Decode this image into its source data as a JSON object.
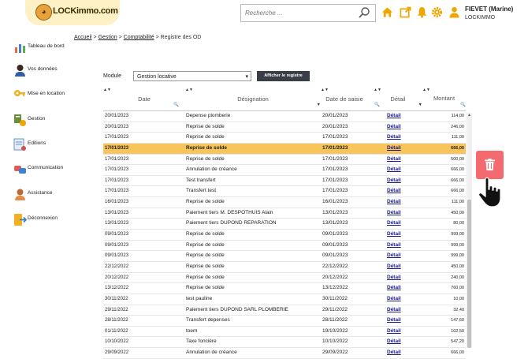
{
  "brand": {
    "logo_text": "LOCKimmo.com"
  },
  "search": {
    "placeholder": "Recherche ..."
  },
  "header_icons": [
    "home-icon",
    "external-link-icon",
    "bell-icon",
    "gear-icon",
    "user-icon"
  ],
  "user": {
    "name": "FIEVET (Marine)",
    "org": "LOCKIMMO"
  },
  "sidebar": {
    "items": [
      {
        "label": "Tableau de bord",
        "icon": "dashboard-icon"
      },
      {
        "label": "Vos données",
        "icon": "person-icon"
      },
      {
        "label": "Mise en location",
        "icon": "key-icon"
      },
      {
        "label": "Gestion",
        "icon": "management-icon"
      },
      {
        "label": "Editions",
        "icon": "editions-icon"
      },
      {
        "label": "Communication",
        "icon": "communication-icon"
      },
      {
        "label": "Assistance",
        "icon": "assistance-icon"
      },
      {
        "label": "Déconnexion",
        "icon": "logout-icon"
      }
    ]
  },
  "breadcrumb": {
    "home": "Accueil",
    "sep": ">",
    "gestion": "Gestion",
    "compta": "Comptabilité",
    "current": "Registre des OD"
  },
  "module": {
    "label": "Module",
    "selected": "Gestion locative",
    "button": "Afficher le registre"
  },
  "table": {
    "columns": {
      "date": "Date",
      "designation": "Désignation",
      "saisie": "Date de saisie",
      "detail": "Détail",
      "montant": "Montant"
    },
    "rows": [
      {
        "date": "20/01/2023",
        "designation": "Depense plomberie",
        "saisie": "20/01/2023",
        "detail": "Détail",
        "montant": "114,00"
      },
      {
        "date": "20/01/2023",
        "designation": "Reprise de solde",
        "saisie": "20/01/2023",
        "detail": "Détail",
        "montant": "246,00"
      },
      {
        "date": "17/01/2023",
        "designation": "Reprise de solde",
        "saisie": "17/01/2023",
        "detail": "Détail",
        "montant": "111,00"
      },
      {
        "date": "17/01/2023",
        "designation": "Reprise de solde",
        "saisie": "17/01/2023",
        "detail": "Détail",
        "montant": "666,00",
        "selected": true
      },
      {
        "date": "17/01/2023",
        "designation": "Reprise de solde",
        "saisie": "17/01/2023",
        "detail": "Détail",
        "montant": "500,00"
      },
      {
        "date": "17/01/2023",
        "designation": "Annulation de créance",
        "saisie": "17/01/2023",
        "detail": "Détail",
        "montant": "666,00"
      },
      {
        "date": "17/01/2023",
        "designation": "Test transfert",
        "saisie": "17/01/2023",
        "detail": "Détail",
        "montant": "666,00"
      },
      {
        "date": "17/01/2023",
        "designation": "Transfert test",
        "saisie": "17/01/2023",
        "detail": "Détail",
        "montant": "666,00"
      },
      {
        "date": "16/01/2023",
        "designation": "Reprise de solde",
        "saisie": "16/01/2023",
        "detail": "Détail",
        "montant": "111,00"
      },
      {
        "date": "13/01/2023",
        "designation": "Paiement tiers M. DESPOTHUIS Alain",
        "saisie": "13/01/2023",
        "detail": "Détail",
        "montant": "450,00"
      },
      {
        "date": "13/01/2023",
        "designation": "Paiement tiers DUPOND REPARATION",
        "saisie": "13/01/2023",
        "detail": "Détail",
        "montant": "80,00"
      },
      {
        "date": "09/01/2023",
        "designation": "Reprise de solde",
        "saisie": "09/01/2023",
        "detail": "Détail",
        "montant": "999,00"
      },
      {
        "date": "09/01/2023",
        "designation": "Reprise de solde",
        "saisie": "09/01/2023",
        "detail": "Détail",
        "montant": "999,00"
      },
      {
        "date": "09/01/2023",
        "designation": "Reprise de solde",
        "saisie": "09/01/2023",
        "detail": "Détail",
        "montant": "999,00"
      },
      {
        "date": "22/12/2022",
        "designation": "Reprise de solde",
        "saisie": "22/12/2022",
        "detail": "Détail",
        "montant": "450,00"
      },
      {
        "date": "20/12/2022",
        "designation": "Reprise de solde",
        "saisie": "20/12/2022",
        "detail": "Détail",
        "montant": "240,00"
      },
      {
        "date": "13/12/2022",
        "designation": "Reprise de solde",
        "saisie": "13/12/2022",
        "detail": "Détail",
        "montant": "760,00"
      },
      {
        "date": "30/11/2022",
        "designation": "test pauline",
        "saisie": "30/11/2022",
        "detail": "Détail",
        "montant": "10,00"
      },
      {
        "date": "29/11/2022",
        "designation": "Paiement tiers DUPOND SARL PLOMBERIE",
        "saisie": "29/11/2022",
        "detail": "Détail",
        "montant": "32,40"
      },
      {
        "date": "28/11/2022",
        "designation": "Transfert depenses",
        "saisie": "28/11/2022",
        "detail": "Détail",
        "montant": "147,60"
      },
      {
        "date": "01/11/2022",
        "designation": "toem",
        "saisie": "19/10/2022",
        "detail": "Détail",
        "montant": "102,50"
      },
      {
        "date": "10/10/2022",
        "designation": "Taxe foncière",
        "saisie": "10/10/2022",
        "detail": "Détail",
        "montant": "547,20"
      },
      {
        "date": "29/09/2022",
        "designation": "Annulation de créance",
        "saisie": "29/09/2022",
        "detail": "Détail",
        "montant": "666,00"
      }
    ]
  },
  "actions": {
    "delete_icon": "trash-icon",
    "cursor_icon": "hand-pointer-icon"
  },
  "colors": {
    "accent": "#f0a500",
    "selected_row": "#f8c45c",
    "delete_button": "#f36a6f",
    "button_dark": "#3a3f46"
  }
}
